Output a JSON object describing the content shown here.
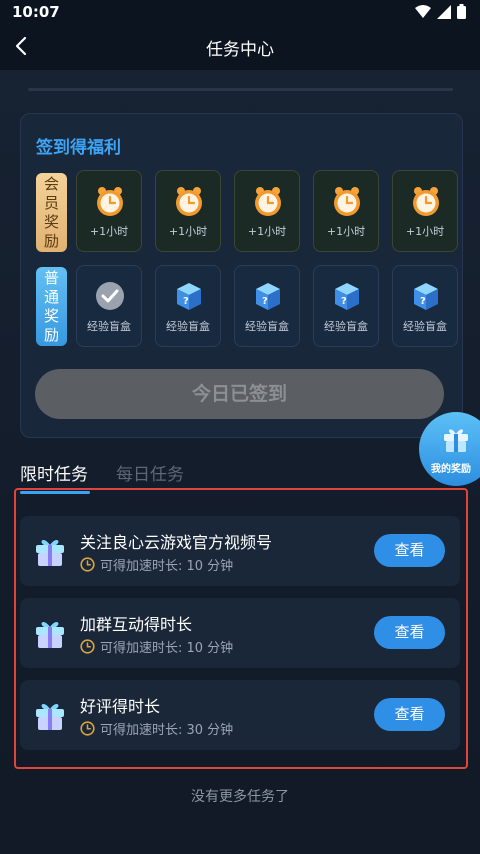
{
  "status_bar": {
    "time": "10:07"
  },
  "header": {
    "title": "任务中心"
  },
  "sign_in": {
    "title": "签到得福利",
    "vip_row": {
      "label": "会员奖励",
      "items": [
        {
          "icon": "alarm-clock-icon",
          "text": "+1小时"
        },
        {
          "icon": "alarm-clock-icon",
          "text": "+1小时"
        },
        {
          "icon": "alarm-clock-icon",
          "text": "+1小时"
        },
        {
          "icon": "alarm-clock-icon",
          "text": "+1小时"
        },
        {
          "icon": "alarm-clock-icon",
          "text": "+1小时"
        }
      ]
    },
    "normal_row": {
      "label": "普通奖励",
      "items": [
        {
          "icon": "checkmark-icon",
          "text": "经验盲盒",
          "claimed": true
        },
        {
          "icon": "mystery-box-icon",
          "text": "经验盲盒",
          "claimed": false
        },
        {
          "icon": "mystery-box-icon",
          "text": "经验盲盒",
          "claimed": false
        },
        {
          "icon": "mystery-box-icon",
          "text": "经验盲盒",
          "claimed": false
        },
        {
          "icon": "mystery-box-icon",
          "text": "经验盲盒",
          "claimed": false
        }
      ]
    },
    "button_label": "今日已签到"
  },
  "tabs": [
    {
      "label": "限时任务",
      "active": true
    },
    {
      "label": "每日任务",
      "active": false
    }
  ],
  "floating": {
    "label": "我的奖励",
    "icon": "gift-icon"
  },
  "tasks": [
    {
      "title": "关注良心云游戏官方视频号",
      "subtitle": "可得加速时长: 10 分钟",
      "button": "查看"
    },
    {
      "title": "加群互动得时长",
      "subtitle": "可得加速时长: 10 分钟",
      "button": "查看"
    },
    {
      "title": "好评得时长",
      "subtitle": "可得加速时长: 30 分钟",
      "button": "查看"
    }
  ],
  "footer": {
    "text": "没有更多任务了"
  },
  "colors": {
    "accent": "#3da3f5",
    "vip_gold": "#e1b271",
    "button_blue": "#2f8ee6",
    "highlight_frame": "#e0443a"
  }
}
